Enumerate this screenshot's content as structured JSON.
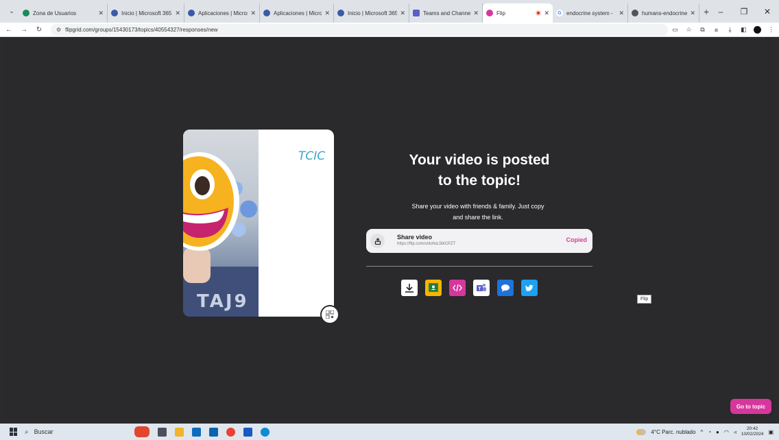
{
  "browser": {
    "tabs": [
      {
        "title": "Zona de Usuarios",
        "favicon": "edge-icon",
        "color": "#1b8a5a"
      },
      {
        "title": "Inicio | Microsoft 365",
        "favicon": "office-icon",
        "color": "#3b5ba9"
      },
      {
        "title": "Aplicaciones | Micros",
        "favicon": "office-icon",
        "color": "#3b5ba9"
      },
      {
        "title": "Aplicaciones | Micros",
        "favicon": "office-icon",
        "color": "#3b5ba9"
      },
      {
        "title": "Inicio | Microsoft 365",
        "favicon": "office-icon",
        "color": "#3b5ba9"
      },
      {
        "title": "Teams and Channels",
        "favicon": "teams-icon",
        "color": "#5b5fc7"
      },
      {
        "title": "Flip",
        "favicon": "flip-icon",
        "color": "#d6379c",
        "active": true
      },
      {
        "title": "endocrine system - ",
        "favicon": "google-icon",
        "color": "#4285f4"
      },
      {
        "title": "humans-endocrine-",
        "favicon": "globe-icon",
        "color": "#555555"
      }
    ],
    "url": "flipgrid.com/groups/15430173/topics/40554327/responses/new"
  },
  "main": {
    "headline_line1": "Your video is posted",
    "headline_line2": "to the topic!",
    "subtext_line1": "Share your video with friends & family. Just copy",
    "subtext_line2": "and share the link.",
    "share_label": "Share video",
    "share_url": "https://flip.com/s/dohsL5bICPZT",
    "copied_label": "Copied",
    "scribble_text": "TCIC",
    "shirt_text": "TAJ9",
    "tooltip": "Flip",
    "go_button": "Go to topic",
    "share_icons": [
      {
        "name": "download-icon",
        "bg": "#ffffff"
      },
      {
        "name": "google-classroom-icon",
        "bg": "#f7b500"
      },
      {
        "name": "embed-code-icon",
        "bg": "#d6379c"
      },
      {
        "name": "microsoft-teams-icon",
        "bg": "#ffffff"
      },
      {
        "name": "remind-icon",
        "bg": "#1d73d8"
      },
      {
        "name": "twitter-icon",
        "bg": "#1da1f2"
      }
    ]
  },
  "taskbar": {
    "search_placeholder": "Buscar",
    "weather": "4°C Parc. nublado",
    "time": "20:42",
    "date": "10/02/2024"
  },
  "colors": {
    "accent": "#d6379c",
    "background": "#2a292c"
  }
}
